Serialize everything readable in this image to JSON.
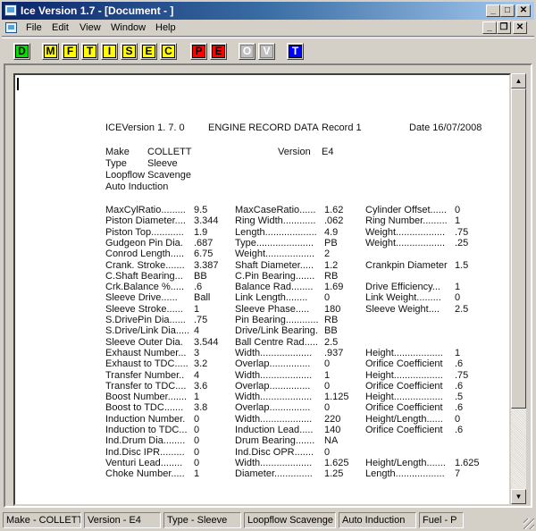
{
  "window": {
    "title": "Ice Version 1.7 - [Document - ]",
    "controls": {
      "minimize": "_",
      "maximize": "□",
      "close": "✕"
    },
    "mdi_controls": {
      "minimize": "_",
      "restore": "❐",
      "close": "✕"
    }
  },
  "menu": [
    "File",
    "Edit",
    "View",
    "Window",
    "Help"
  ],
  "toolbar": [
    {
      "label": "D",
      "color": "green",
      "enabled": true
    },
    {
      "label": "M",
      "color": "yellow",
      "enabled": true
    },
    {
      "label": "F",
      "color": "yellow",
      "enabled": true
    },
    {
      "label": "T",
      "color": "yellow",
      "enabled": true
    },
    {
      "label": "I",
      "color": "yellow",
      "enabled": true
    },
    {
      "label": "S",
      "color": "yellow",
      "enabled": true
    },
    {
      "label": "E",
      "color": "yellow",
      "enabled": true
    },
    {
      "label": "C",
      "color": "yellow",
      "enabled": true
    },
    {
      "label": "P",
      "color": "red",
      "enabled": true
    },
    {
      "label": "E",
      "color": "red",
      "enabled": true
    },
    {
      "label": "O",
      "color": "gray",
      "enabled": false
    },
    {
      "label": "V",
      "color": "gray",
      "enabled": false
    },
    {
      "label": "T",
      "color": "blue",
      "enabled": true
    }
  ],
  "report": {
    "header": {
      "version": "ICEVersion  1. 7. 0",
      "title": "ENGINE RECORD DATA",
      "record": "Record 1",
      "date": "Date 16/07/2008"
    },
    "info": {
      "make_label": "Make",
      "make": "COLLETT",
      "type_label": "Type",
      "type": "Sleeve",
      "scavenge": "Loopflow Scavenge",
      "induction": "Auto Induction",
      "version_label": "Version",
      "version": "E4"
    },
    "rows": [
      [
        [
          "MaxCylRatio.........",
          "9.5"
        ],
        [
          "MaxCaseRatio......",
          "1.62"
        ],
        [
          "Cylinder Offset......",
          "0"
        ]
      ],
      [
        [
          "Piston Diameter....",
          "3.344"
        ],
        [
          "Ring Width............",
          ".062"
        ],
        [
          "Ring Number.........",
          "1"
        ]
      ],
      [
        [
          "Piston Top............",
          "1.9"
        ],
        [
          "Length...................",
          "4.9"
        ],
        [
          "Weight..................",
          ".75"
        ]
      ],
      [
        [
          "Gudgeon Pin Dia.",
          ".687"
        ],
        [
          "Type.....................",
          "PB"
        ],
        [
          "Weight..................",
          ".25"
        ]
      ],
      [
        [
          "Conrod Length.....",
          "6.75"
        ],
        [
          "Weight..................",
          "2"
        ],
        [
          "",
          ""
        ]
      ],
      [
        [
          "Crank. Stroke.......",
          "3.387"
        ],
        [
          "Shaft Diameter.....",
          "1.2"
        ],
        [
          "Crankpin Diameter",
          "1.5"
        ]
      ],
      [
        [
          "C.Shaft Bearing...",
          "BB"
        ],
        [
          "C.Pin Bearing.......",
          "RB"
        ],
        [
          "",
          ""
        ]
      ],
      [
        [
          "Crk.Balance %.....",
          ".6"
        ],
        [
          "Balance Rad........",
          "1.69"
        ],
        [
          "Drive Efficiency...",
          "1"
        ]
      ],
      [
        [
          "Sleeve Drive......",
          "Ball"
        ],
        [
          "Link Length........",
          "0"
        ],
        [
          "Link Weight.........",
          "0"
        ]
      ],
      [
        [
          "Sleeve Stroke......",
          "1"
        ],
        [
          "Sleeve Phase.....",
          "180"
        ],
        [
          "Sleeve Weight....",
          "2.5"
        ]
      ],
      [
        [
          "S.DrivePin Dia......",
          ".75"
        ],
        [
          "Pin Bearing............",
          "RB"
        ],
        [
          "",
          ""
        ]
      ],
      [
        [
          "S.Drive/Link Dia.....",
          "4"
        ],
        [
          "Drive/Link Bearing.",
          "BB"
        ],
        [
          "",
          ""
        ]
      ],
      [
        [
          "Sleeve Outer Dia.",
          "3.544"
        ],
        [
          "Ball Centre Rad.....",
          "2.5"
        ],
        [
          "",
          ""
        ]
      ],
      [
        [
          "Exhaust Number...",
          "3"
        ],
        [
          "Width...................",
          ".937"
        ],
        [
          "Height..................",
          "1"
        ]
      ],
      [
        [
          "Exhaust to TDC.....",
          "3.2"
        ],
        [
          "Overlap...............",
          "0"
        ],
        [
          "Orifice Coefficient",
          ".6"
        ]
      ],
      [
        [
          "Transfer Number..",
          "4"
        ],
        [
          "Width...................",
          "1"
        ],
        [
          "Height..................",
          ".75"
        ]
      ],
      [
        [
          "Transfer to TDC....",
          "3.6"
        ],
        [
          "Overlap...............",
          "0"
        ],
        [
          "Orifice Coefficient",
          ".6"
        ]
      ],
      [
        [
          "Boost Number.......",
          "1"
        ],
        [
          "Width...................",
          "1.125"
        ],
        [
          "Height..................",
          ".5"
        ]
      ],
      [
        [
          "Boost to TDC.......",
          "3.8"
        ],
        [
          "Overlap...............",
          "0"
        ],
        [
          "Orifice Coefficient",
          ".6"
        ]
      ],
      [
        [
          "Induction Number.",
          "0"
        ],
        [
          "Width...................",
          "220"
        ],
        [
          "Height/Length......",
          "0"
        ]
      ],
      [
        [
          "Induction to TDC...",
          "0"
        ],
        [
          "Induction Lead.....",
          "140"
        ],
        [
          "Orifice Coefficient",
          ".6"
        ]
      ],
      [
        [
          "Ind.Drum Dia........",
          "0"
        ],
        [
          "Drum Bearing.......",
          "NA"
        ],
        [
          "",
          ""
        ]
      ],
      [
        [
          "Ind.Disc IPR.........",
          "0"
        ],
        [
          "Ind.Disc OPR.......",
          "0"
        ],
        [
          "",
          ""
        ]
      ],
      [
        [
          "Venturi Lead........",
          "0"
        ],
        [
          "Width...................",
          "1.625"
        ],
        [
          "Height/Length.......",
          "1.625"
        ]
      ],
      [
        [
          "Choke Number.....",
          "1"
        ],
        [
          "Diameter..............",
          "1.25"
        ],
        [
          "Length..................",
          "7"
        ]
      ]
    ]
  },
  "statusbar": [
    "Make - COLLETT",
    "Version - E4",
    "Type - Sleeve",
    "Loopflow Scavenge",
    "Auto Induction",
    "Fuel - P"
  ]
}
